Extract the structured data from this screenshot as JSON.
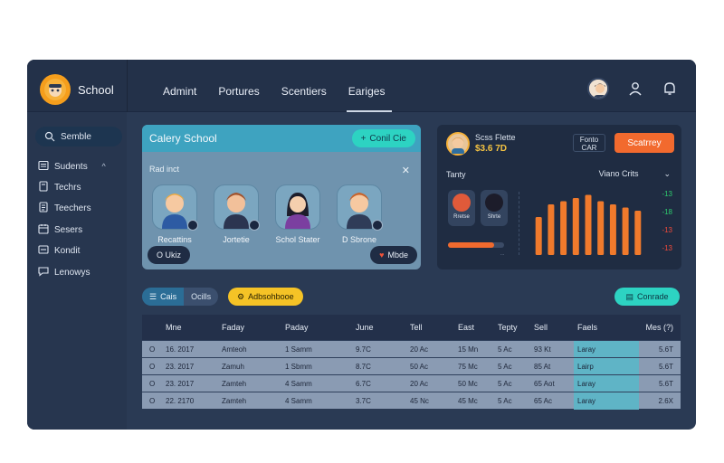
{
  "brand": {
    "name": "School",
    "logo_icon": "owl-logo-icon"
  },
  "nav": [
    {
      "label": "Admint",
      "active": false
    },
    {
      "label": "Portures",
      "active": false
    },
    {
      "label": "Scentiers",
      "active": false
    },
    {
      "label": "Eariges",
      "active": true
    }
  ],
  "top_icons": [
    "user-avatar",
    "user-icon",
    "bell-icon"
  ],
  "sidebar": {
    "items": [
      {
        "label": "Semble",
        "icon": "search-icon",
        "active": true
      },
      {
        "label": "Sudents",
        "icon": "list-icon",
        "chevron": "^"
      },
      {
        "label": "Techrs",
        "icon": "book-icon"
      },
      {
        "label": "Teechers",
        "icon": "doc-icon"
      },
      {
        "label": "Sesers",
        "icon": "calendar-icon"
      },
      {
        "label": "Kondit",
        "icon": "settings-icon"
      },
      {
        "label": "Lenowys",
        "icon": "chat-icon"
      }
    ]
  },
  "left_panel": {
    "title": "Calery School",
    "action_label": "Conil Cie",
    "subtitle": "Rad inct",
    "people": [
      {
        "name": "Recattins"
      },
      {
        "name": "Jortetie"
      },
      {
        "name": "Schol Stater"
      },
      {
        "name": "D Sbrone"
      }
    ],
    "btn_left": "O Ukiz",
    "btn_right": "Mbde"
  },
  "right_panel": {
    "profile_name": "Scss Flette",
    "profile_number": "$3.6 7D",
    "mid_box": [
      "Fonto",
      "CAR"
    ],
    "action_label": "Scatrrey",
    "section_label": "Tanty",
    "dropdown_label": "Viano Crits",
    "thumbs": [
      {
        "label": "Rretse"
      },
      {
        "label": "Shrte"
      }
    ],
    "slider": {
      "value": 0.82,
      "label": "..."
    },
    "bar_values": [
      0.6,
      0.8,
      0.85,
      0.9,
      0.95,
      0.85,
      0.8,
      0.75,
      0.7
    ],
    "bar_color": "#f07a2c",
    "side_values": [
      {
        "text": "-13",
        "color": "#2ecb6e"
      },
      {
        "text": "-18",
        "color": "#2ecb6e"
      },
      {
        "text": "-13",
        "color": "#f04a3a"
      },
      {
        "text": "-13",
        "color": "#f04a3a"
      }
    ]
  },
  "toolbar": {
    "tabs": [
      {
        "label": "Cais",
        "active": true
      },
      {
        "label": "Ocills",
        "active": false
      }
    ],
    "chip_label": "Adbsohbooe",
    "action_label": "Conrade"
  },
  "table": {
    "headers": [
      "",
      "Mne",
      "Faday",
      "Paday",
      "June",
      "Tell",
      "East",
      "Tepty",
      "Sell",
      "Faels",
      "Mes (?)"
    ],
    "rows": [
      [
        "O",
        "16. 2017",
        "Amteoh",
        "1 Samm",
        "9.7C",
        "20 Ac",
        "15 Mn",
        "5 Ac",
        "93 Kt",
        "Laray",
        "5.6T"
      ],
      [
        "O",
        "23. 2017",
        "Zamuh",
        "1 Sbmm",
        "8.7C",
        "50 Ac",
        "75 Mc",
        "5 Ac",
        "85 At",
        "Lairp",
        "5.6T"
      ],
      [
        "O",
        "23. 2017",
        "Zamteh",
        "4 Samm",
        "6.7C",
        "20 Ac",
        "50 Mc",
        "5 Ac",
        "65 Aot",
        "Laray",
        "5.6T"
      ],
      [
        "O",
        "22. 2170",
        "Zamteh",
        "4 Samm",
        "3.7C",
        "45 Nc",
        "45 Mc",
        "5 Ac",
        "65 Ac",
        "Laray",
        "2.6X"
      ]
    ],
    "highlight_color": "#5fb4c6"
  },
  "colors": {
    "app_bg": "#2a3a54",
    "accent_teal": "#2dd3c2",
    "accent_orange": "#f26a2e",
    "accent_yellow": "#f5c326"
  }
}
